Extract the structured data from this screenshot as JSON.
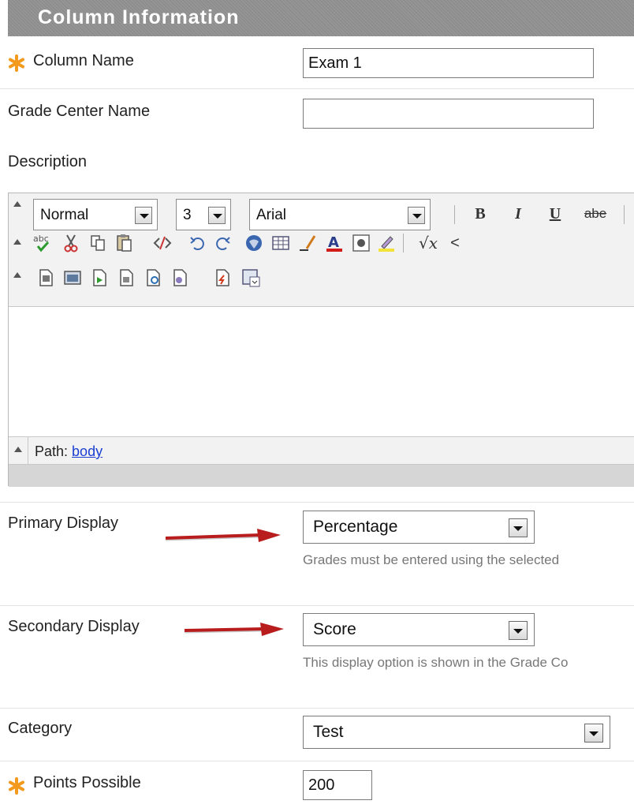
{
  "section_title": "Column Information",
  "column_name": {
    "label": "Column Name",
    "value": "Exam 1",
    "required": true
  },
  "grade_center_name": {
    "label": "Grade Center Name",
    "value": ""
  },
  "description": {
    "label": "Description"
  },
  "editor": {
    "format": "Normal",
    "size": "3",
    "font": "Arial",
    "text_buttons": {
      "bold": "B",
      "italic": "I",
      "underline": "U",
      "strike": "abe"
    },
    "path_label": "Path:",
    "path_value": "body"
  },
  "primary_display": {
    "label": "Primary Display",
    "value": "Percentage",
    "help": "Grades must be entered using the selected"
  },
  "secondary_display": {
    "label": "Secondary Display",
    "value": "Score",
    "help": "This display option is shown in the Grade Co"
  },
  "category": {
    "label": "Category",
    "value": "Test"
  },
  "points_possible": {
    "label": "Points Possible",
    "value": "200",
    "required": true
  },
  "colors": {
    "required_star": "#f39a1e",
    "annotation_arrow": "#b81c1c",
    "link": "#1a3fd1"
  }
}
